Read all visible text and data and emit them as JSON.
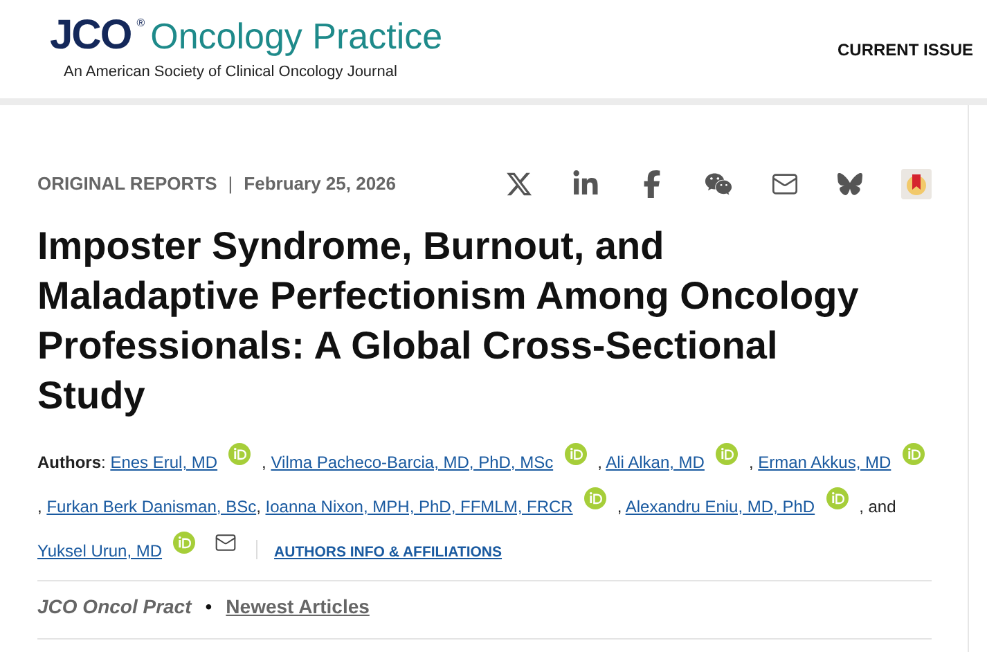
{
  "header": {
    "logo_mark": "JCO",
    "logo_reg": "®",
    "logo_name": "Oncology Practice",
    "tagline": "An American Society of Clinical Oncology Journal",
    "nav": [
      "CURRENT ISSUE"
    ]
  },
  "article": {
    "section": "ORIGINAL REPORTS",
    "divider": "|",
    "date": "February 25, 2026",
    "share": [
      {
        "kind": "x"
      },
      {
        "kind": "linkedin"
      },
      {
        "kind": "facebook"
      },
      {
        "kind": "wechat"
      },
      {
        "kind": "mail"
      },
      {
        "kind": "butterfly"
      },
      {
        "kind": "app"
      }
    ],
    "title": "Imposter Syndrome, Burnout, and Maladaptive Perfectionism Among Oncology Professionals: A Global Cross-Sectional Study",
    "authors_label": "Authors",
    "authors": [
      {
        "before": ":",
        "name": "Enes Erul, MD",
        "orcid": true
      },
      {
        "before": ",",
        "name": "Vilma Pacheco-Barcia, MD, PhD, MSc",
        "orcid": true
      },
      {
        "before": ",",
        "name": "Ali Alkan, MD",
        "orcid": true
      },
      {
        "before": ",",
        "name": "Erman Akkus, MD",
        "orcid": true
      },
      {
        "before": ",",
        "name": "Furkan Berk Danisman, BSc",
        "orcid": false
      },
      {
        "before": ",",
        "name": "Ioanna Nixon, MPH, PhD, FFMLM, FRCR",
        "orcid": true
      },
      {
        "before": ",",
        "name": "Alexandru Eniu, MD, PhD",
        "orcid": true
      },
      {
        "before": ", and",
        "name": "Yuksel Urun, MD",
        "orcid": true,
        "mail": true
      }
    ],
    "affiliations_link": "AUTHORS INFO & AFFILIATIONS",
    "journal": "JCO Oncol Pract",
    "bullet": "•",
    "newest_link": "Newest Articles"
  }
}
